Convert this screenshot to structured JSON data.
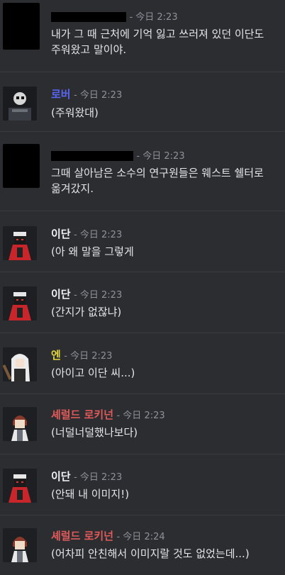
{
  "colors": {
    "background": "#2b2d31",
    "name_white": "#f2f3f5",
    "name_blue": "#5865f2",
    "name_yellow": "#e2d43b",
    "name_red": "#e05a5a",
    "timestamp": "#8e9297",
    "separator": "#3a3c42"
  },
  "messages": [
    {
      "author": "",
      "timestamp": "- 今日 2:23",
      "text": "내가 그 때 근처에 기억 잃고 쓰러져 있던 이단도 주워왔고 말이야.",
      "avatar_icon": "redacted-avatar"
    },
    {
      "author": "로버",
      "timestamp": "- 今日 2:23",
      "text": "(주워왔대)",
      "avatar_icon": "skull-mask-avatar"
    },
    {
      "author": "",
      "timestamp": "- 今日 2:23",
      "text": "그때 살아남은 소수의 연구원들은 웨스트 쉘터로 옮겨갔지.",
      "avatar_icon": "redacted-avatar"
    },
    {
      "author": "이단",
      "timestamp": "- 今日 2:23",
      "text": "(아 왜 말을 그렇게",
      "avatar_icon": "red-cloak-avatar"
    },
    {
      "author": "이단",
      "timestamp": "- 今日 2:23",
      "text": "(간지가 없잖냐)",
      "avatar_icon": "red-cloak-avatar"
    },
    {
      "author": "엔",
      "timestamp": "- 今日 2:23",
      "text": "(아이고 이단 씨...)",
      "avatar_icon": "white-hair-avatar"
    },
    {
      "author": "셰럴드 로키넌",
      "timestamp": "- 今日 2:23",
      "text": "(너덜너덜했나보다)",
      "avatar_icon": "brown-hair-avatar"
    },
    {
      "author": "이단",
      "timestamp": "- 今日 2:23",
      "text": "(안돼 내 이미지!)",
      "avatar_icon": "red-cloak-avatar"
    },
    {
      "author": "셰럴드 로키넌",
      "timestamp": "- 今日 2:24",
      "text": "(어차피 안친해서 이미지랄 것도 없었는데...)",
      "avatar_icon": "brown-hair-avatar"
    }
  ]
}
